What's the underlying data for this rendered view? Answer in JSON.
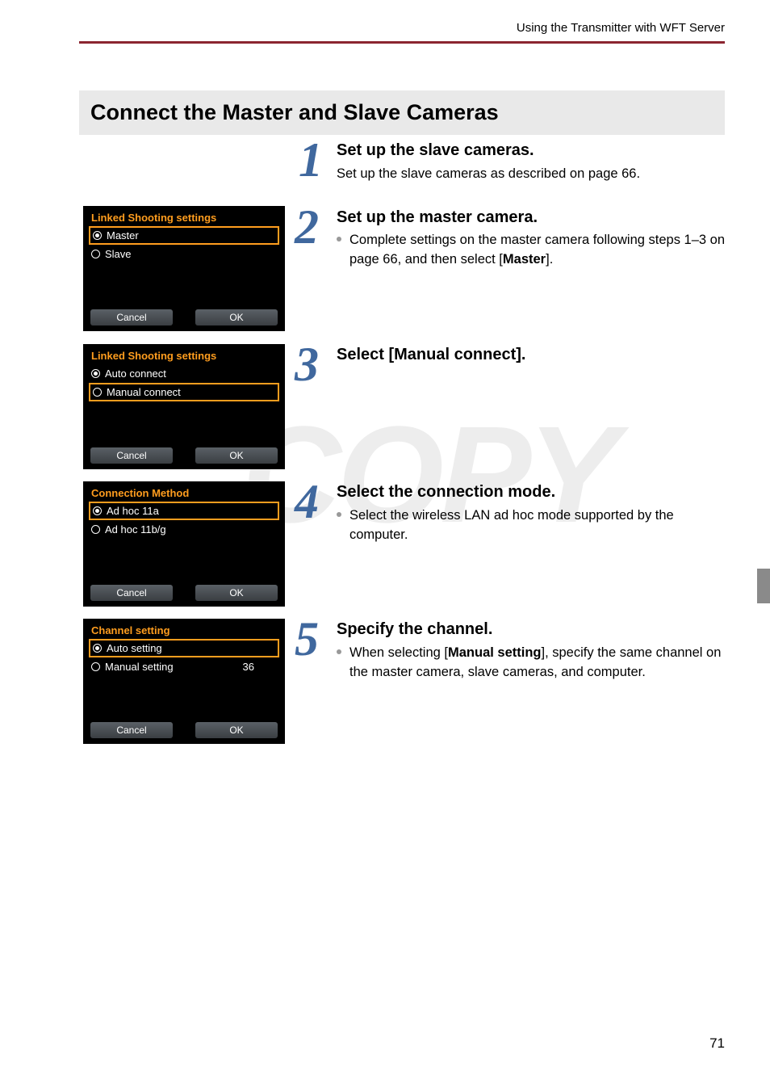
{
  "page": {
    "header": "Using the Transmitter with WFT Server",
    "number": "71",
    "watermark": "COPY"
  },
  "section_title": "Connect the Master and Slave Cameras",
  "steps": {
    "s1": {
      "num": "1",
      "title": "Set up the slave cameras.",
      "body": "Set up the slave cameras as described on page 66."
    },
    "s2": {
      "num": "2",
      "title": "Set up the master camera.",
      "body_pre": "Complete settings on the master camera following steps 1–3 on page 66, and then select [",
      "body_bold": "Master",
      "body_post": "]."
    },
    "s3": {
      "num": "3",
      "title": "Select [Manual connect]."
    },
    "s4": {
      "num": "4",
      "title": "Select the connection mode.",
      "body": "Select the wireless LAN ad hoc mode supported by the computer."
    },
    "s5": {
      "num": "5",
      "title": "Specify the channel.",
      "body_pre": "When selecting [",
      "body_bold": "Manual setting",
      "body_post": "], specify the same channel on the master camera, slave cameras, and computer."
    }
  },
  "screens": {
    "sc2": {
      "title": "Linked Shooting settings",
      "opt1": "Master",
      "opt2": "Slave",
      "cancel": "Cancel",
      "ok": "OK"
    },
    "sc3": {
      "title": "Linked Shooting settings",
      "opt1": "Auto connect",
      "opt2": "Manual connect",
      "cancel": "Cancel",
      "ok": "OK"
    },
    "sc4": {
      "title": "Connection Method",
      "opt1": "Ad hoc 11a",
      "opt2": "Ad hoc 11b/g",
      "cancel": "Cancel",
      "ok": "OK"
    },
    "sc5": {
      "title": "Channel setting",
      "opt1": "Auto setting",
      "opt2": "Manual setting",
      "val2": "36",
      "cancel": "Cancel",
      "ok": "OK"
    }
  }
}
